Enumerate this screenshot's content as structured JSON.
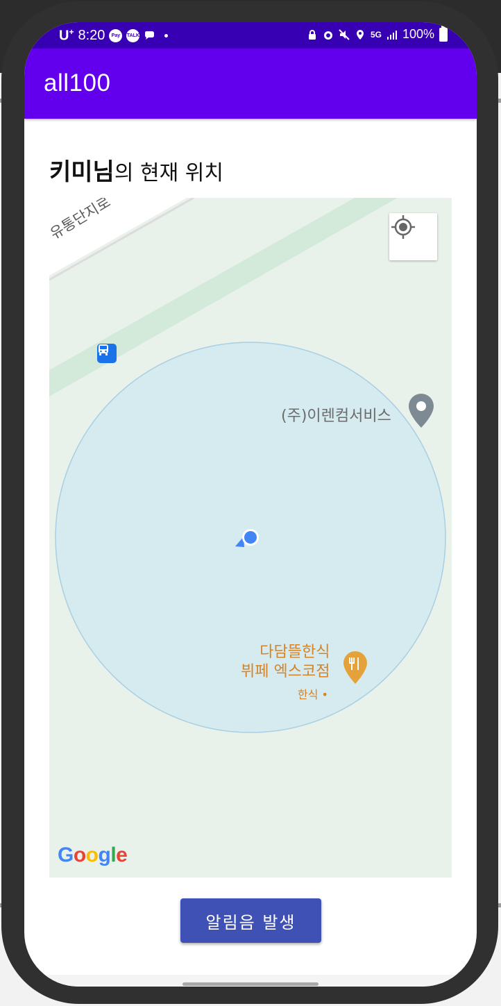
{
  "status_bar": {
    "carrier": "U",
    "carrier_sup": "+",
    "time": "8:20",
    "notif_pay": "Pay",
    "notif_talk": "TALK",
    "network": "5G",
    "battery": "100%"
  },
  "app_bar": {
    "title": "all100"
  },
  "heading": {
    "user": "키미님",
    "suffix": "의 현재 위치"
  },
  "map": {
    "road_label": "유통단지로",
    "poi_company": "(주)이렌컴서비스",
    "poi_restaurant_line1": "다담뜰한식",
    "poi_restaurant_line2": "뷔페 엑스코점",
    "poi_restaurant_category": "한식 •",
    "attribution": "Google",
    "colors": {
      "land": "#e9f2ea",
      "park_strip": "#d3eadb",
      "accuracy_circle": "#d6ebef",
      "blue_dot": "#4285f4",
      "poi_pin_gray": "#7d8a93",
      "poi_pin_food": "#e5a23b"
    }
  },
  "actions": {
    "alarm_button": "알림음 발생"
  },
  "colors": {
    "status_bar": "#3700b3",
    "app_bar": "#6200ee",
    "button": "#3f51b5"
  }
}
